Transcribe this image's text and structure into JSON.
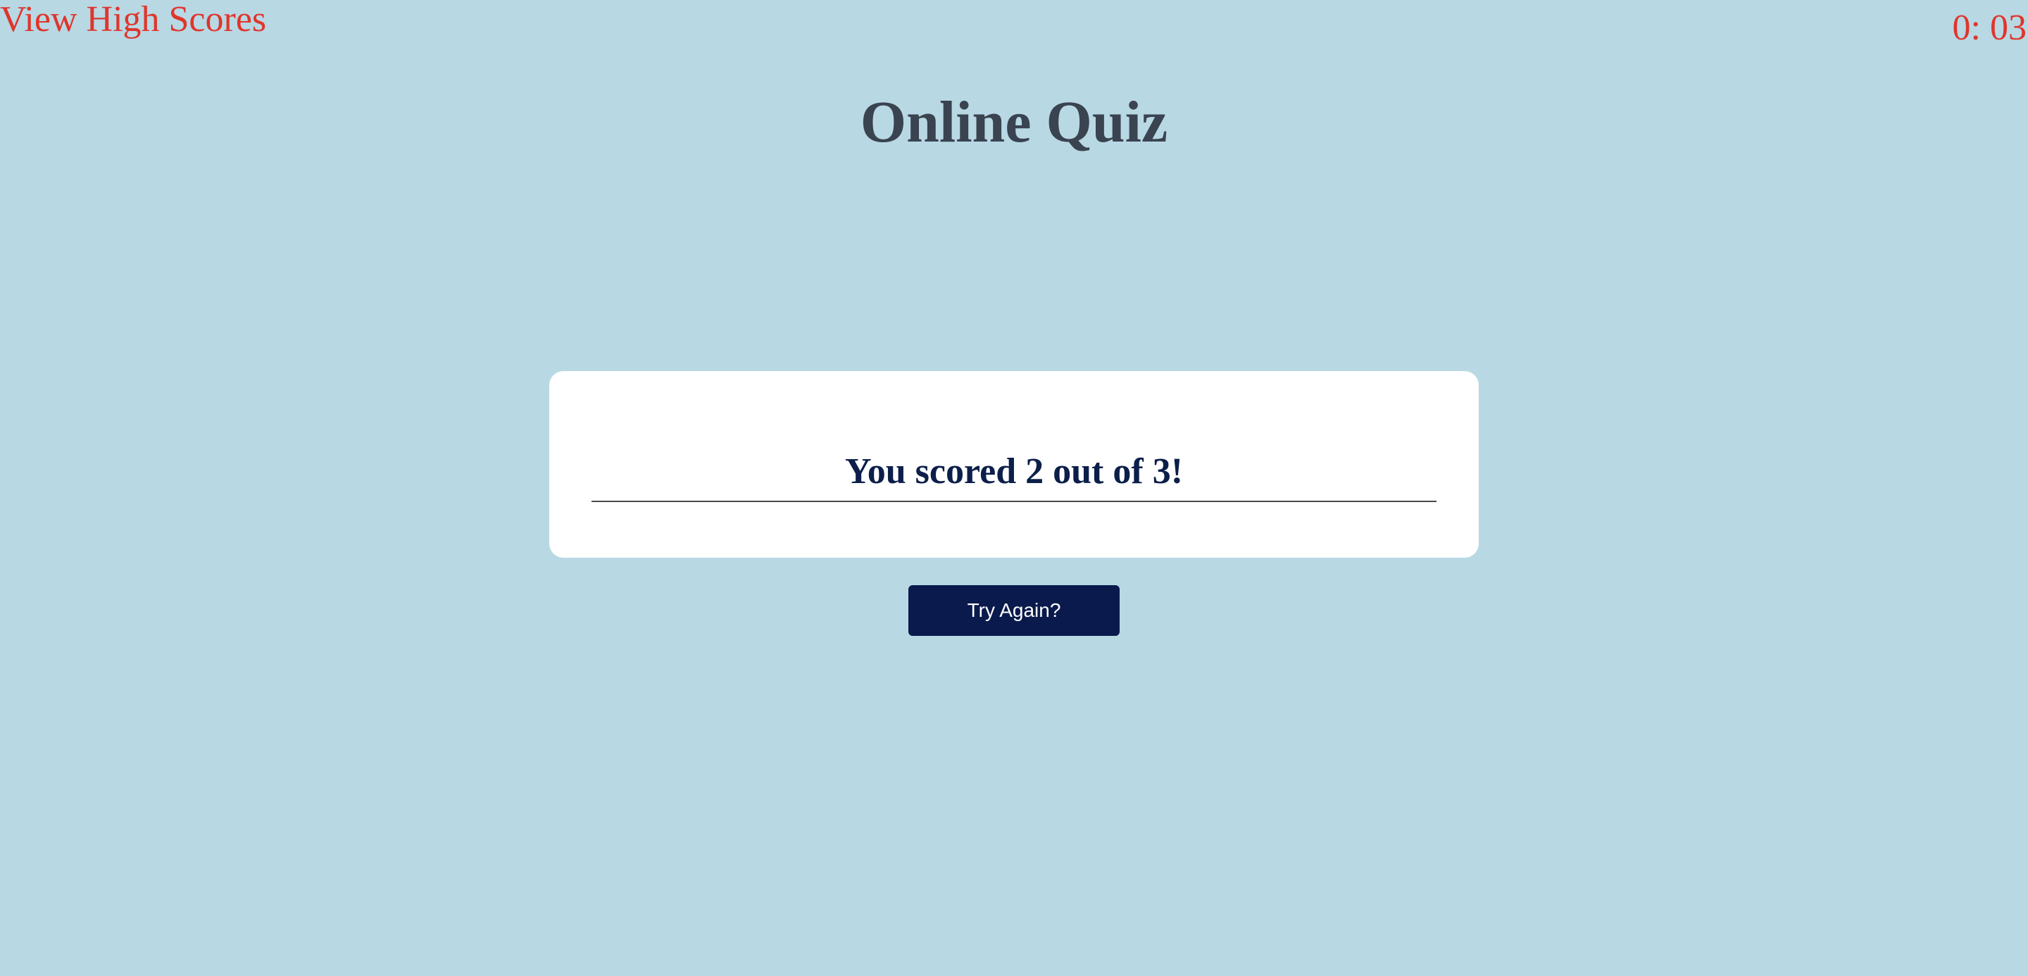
{
  "header": {
    "high_scores_label": "View High Scores",
    "timer": "0: 03"
  },
  "page": {
    "title": "Online Quiz"
  },
  "result": {
    "message": "You scored 2 out of 3!"
  },
  "actions": {
    "try_again_label": "Try Again?"
  },
  "colors": {
    "background": "#b8d8e4",
    "accent_red": "#e0352b",
    "title_gray": "#3a4350",
    "navy": "#0a1a4c",
    "card": "#ffffff"
  }
}
